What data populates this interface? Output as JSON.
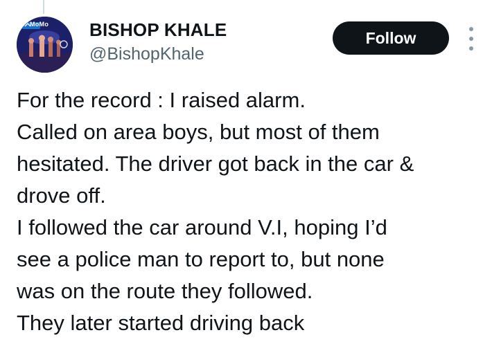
{
  "author": {
    "display_name": "BISHOP KHALE",
    "handle": "@BishopKhale",
    "avatar_badge": "MoMo",
    "avatar_icon": "profile-photo-concert"
  },
  "actions": {
    "follow_label": "Follow",
    "more_icon": "vertical-ellipsis-icon"
  },
  "tweet": {
    "lines": [
      "For the record : I raised alarm.",
      "Called on area boys, but most of them",
      "hesitated. The driver got back in the car &",
      "drove off.",
      "I followed the car around V.I, hoping I’d",
      "see a police man to report to, but none",
      "was on the route they followed.",
      "They later started driving back"
    ]
  },
  "colors": {
    "text_primary": "#0f1419",
    "text_secondary": "#536471",
    "button_bg": "#0f1419",
    "button_text": "#ffffff",
    "thread_line": "#cfd9de"
  }
}
